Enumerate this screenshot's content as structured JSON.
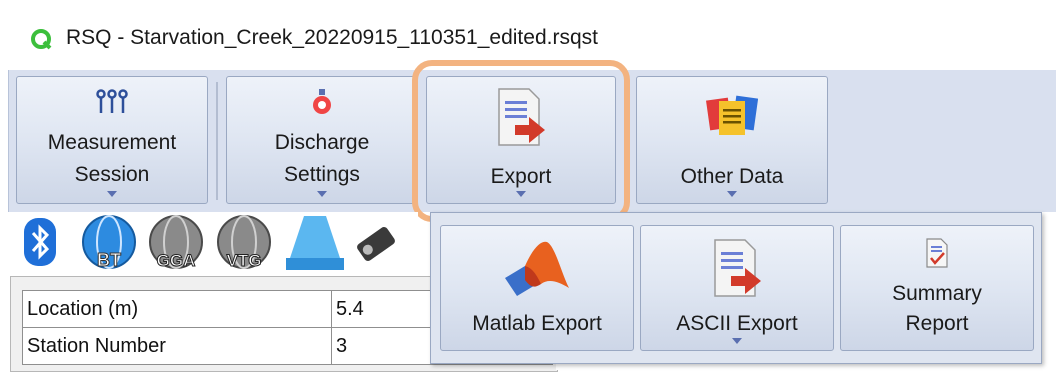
{
  "window": {
    "title": "RSQ - Starvation_Creek_20220915_110351_edited.rsqst"
  },
  "ribbon": {
    "measurement_session": {
      "line1": "Measurement",
      "line2": "Session",
      "icon": "people-icon"
    },
    "discharge_settings": {
      "line1": "Discharge",
      "line2": "Settings",
      "icon": "flask-gear-icon"
    },
    "export": {
      "label": "Export",
      "icon": "document-arrow-icon"
    },
    "other_data": {
      "label": "Other Data",
      "icon": "notes-stack-icon"
    }
  },
  "export_menu": {
    "matlab_export": {
      "label": "Matlab Export",
      "icon": "matlab-icon"
    },
    "ascii_export": {
      "label": "ASCII Export",
      "icon": "document-arrow-icon"
    },
    "summary_report": {
      "line1": "Summary",
      "line2": "Report",
      "icon": "report-check-icon"
    }
  },
  "toolbar_icons": {
    "bt": "BT",
    "gga": "GGA",
    "vtg": "VTG"
  },
  "station_table": [
    {
      "name": "Location (m)",
      "value": "5.4"
    },
    {
      "name": "Station Number",
      "value": "3"
    }
  ],
  "colors": {
    "highlight": "#f3b380",
    "ribbon": "#d9e0ef",
    "accent_red": "#d23a2a",
    "logo_green": "#3cbf3c"
  }
}
